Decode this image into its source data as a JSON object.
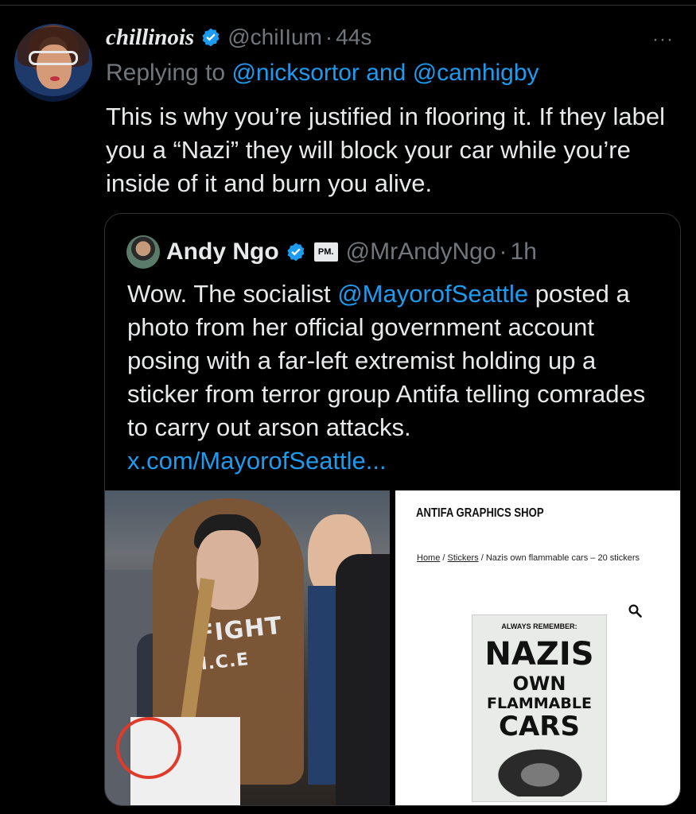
{
  "tweet": {
    "display_name": "chillinois",
    "handle": "@chiIIum",
    "separator": "·",
    "time": "44s",
    "more_label": "···",
    "replying_prefix": "Replying to",
    "replying_to_1": "@nicksortor",
    "replying_and": "and",
    "replying_to_2": "@camhigby",
    "text": "This is why you’re justified in flooring it. If they label you a “Nazi” they will block your car while you’re inside of it and burn you alive."
  },
  "quote": {
    "display_name": "Andy Ngo",
    "badge": "PM.",
    "handle": "@MrAndyNgo",
    "separator": "·",
    "time": "1h",
    "text_part1": "Wow. The socialist",
    "mention": "@MayorofSeattle",
    "text_part2": "posted a photo from her official government account posing with a far-left extremist holding up a sticker from terror group Antifa telling comrades to carry out arson attacks.",
    "link": "x.com/MayorofSeattle..."
  },
  "photo": {
    "hoodie_text": "FIGHT",
    "hoodie_subtext": "I.C.E"
  },
  "shop": {
    "title": "ANTIFA GRAPHICS SHOP",
    "crumb_home": "Home",
    "crumb_sep": "/",
    "crumb_stickers": "Stickers",
    "crumb_current": "Nazis own flammable cars – 20 stickers",
    "sticker_top": "ALWAYS REMEMBER:",
    "sticker_line1": "NAZIS",
    "sticker_line2": "OWN",
    "sticker_line3": "FLAMMABLE",
    "sticker_line4": "CARS"
  },
  "colors": {
    "background": "#000000",
    "text": "#e7e9ea",
    "muted": "#71767b",
    "link": "#1d9bf0",
    "verified": "#1d9bf0",
    "border": "#2f3336"
  }
}
